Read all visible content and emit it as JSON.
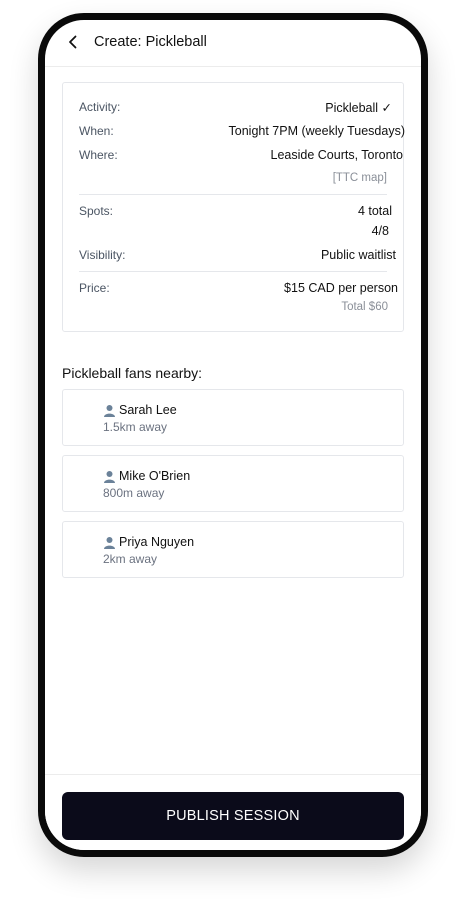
{
  "header": {
    "title": "Create: Pickleball",
    "back_icon": "chevron-left-icon"
  },
  "summary": {
    "activity": {
      "label": "Activity:",
      "value": "Pickleball ✓"
    },
    "when": {
      "label": "When:",
      "value": "Tonight 7PM (weekly Tuesdays)"
    },
    "where": {
      "label": "Where:",
      "value": "Leaside Courts, Toronto",
      "link": "[TTC map]"
    },
    "spots": {
      "label": "Spots:",
      "value": "4 total",
      "sub": "4/8"
    },
    "visibility": {
      "label": "Visibility:",
      "value": "Public waitlist"
    },
    "price": {
      "label": "Price:",
      "value": "$15 CAD per person",
      "sub": "Total $60"
    }
  },
  "nearby": {
    "title": "Pickleball fans nearby:",
    "people": [
      {
        "icon": "👤",
        "name": "Sarah Lee",
        "distance": "1.5km away"
      },
      {
        "icon": "👤",
        "name": "Mike O'Brien",
        "distance": "800m away"
      },
      {
        "icon": "👤",
        "name": "Priya Nguyen",
        "distance": "2km away"
      }
    ]
  },
  "footer": {
    "publish_label": "PUBLISH SESSION"
  },
  "colors": {
    "primary_button": "#0b0b1a",
    "icon_blue": "#64748b",
    "border": "#e5e7eb"
  }
}
